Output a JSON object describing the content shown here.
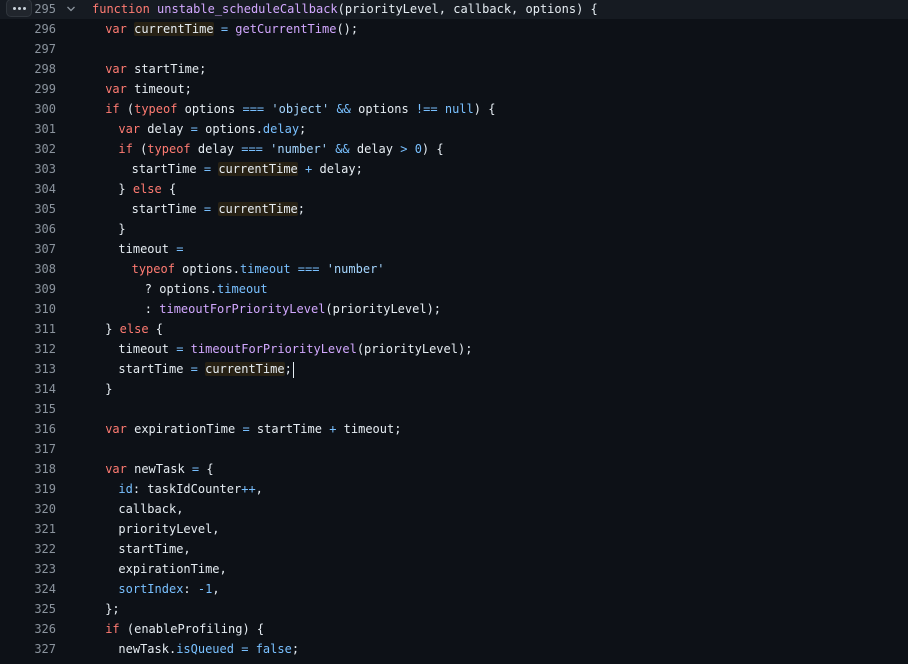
{
  "editor": {
    "indent": "  ",
    "lines": [
      {
        "n": "295",
        "indent": 0,
        "active": true,
        "tokens": [
          {
            "t": "function",
            "c": "kw"
          },
          {
            "t": " ",
            "c": "plain"
          },
          {
            "t": "unstable_scheduleCallback",
            "c": "fn"
          },
          {
            "t": "(priorityLevel, callback, options) {",
            "c": "plain"
          }
        ]
      },
      {
        "n": "296",
        "indent": 1,
        "tokens": [
          {
            "t": "var",
            "c": "kw"
          },
          {
            "t": " ",
            "c": "plain"
          },
          {
            "t": "currentTime",
            "c": "plain",
            "hl": true
          },
          {
            "t": " ",
            "c": "plain"
          },
          {
            "t": "=",
            "c": "op"
          },
          {
            "t": " ",
            "c": "plain"
          },
          {
            "t": "getCurrentTime",
            "c": "fn"
          },
          {
            "t": "();",
            "c": "plain"
          }
        ]
      },
      {
        "n": "297",
        "indent": 0,
        "tokens": []
      },
      {
        "n": "298",
        "indent": 1,
        "tokens": [
          {
            "t": "var",
            "c": "kw"
          },
          {
            "t": " startTime;",
            "c": "plain"
          }
        ]
      },
      {
        "n": "299",
        "indent": 1,
        "tokens": [
          {
            "t": "var",
            "c": "kw"
          },
          {
            "t": " timeout;",
            "c": "plain"
          }
        ]
      },
      {
        "n": "300",
        "indent": 1,
        "tokens": [
          {
            "t": "if",
            "c": "kw"
          },
          {
            "t": " (",
            "c": "plain"
          },
          {
            "t": "typeof",
            "c": "kw"
          },
          {
            "t": " options ",
            "c": "plain"
          },
          {
            "t": "===",
            "c": "op"
          },
          {
            "t": " ",
            "c": "plain"
          },
          {
            "t": "'object'",
            "c": "str"
          },
          {
            "t": " ",
            "c": "plain"
          },
          {
            "t": "&&",
            "c": "op"
          },
          {
            "t": " options ",
            "c": "plain"
          },
          {
            "t": "!==",
            "c": "op"
          },
          {
            "t": " ",
            "c": "plain"
          },
          {
            "t": "null",
            "c": "num"
          },
          {
            "t": ") {",
            "c": "plain"
          }
        ]
      },
      {
        "n": "301",
        "indent": 2,
        "tokens": [
          {
            "t": "var",
            "c": "kw"
          },
          {
            "t": " delay ",
            "c": "plain"
          },
          {
            "t": "=",
            "c": "op"
          },
          {
            "t": " options.",
            "c": "plain"
          },
          {
            "t": "delay",
            "c": "prop"
          },
          {
            "t": ";",
            "c": "plain"
          }
        ]
      },
      {
        "n": "302",
        "indent": 2,
        "tokens": [
          {
            "t": "if",
            "c": "kw"
          },
          {
            "t": " (",
            "c": "plain"
          },
          {
            "t": "typeof",
            "c": "kw"
          },
          {
            "t": " delay ",
            "c": "plain"
          },
          {
            "t": "===",
            "c": "op"
          },
          {
            "t": " ",
            "c": "plain"
          },
          {
            "t": "'number'",
            "c": "str"
          },
          {
            "t": " ",
            "c": "plain"
          },
          {
            "t": "&&",
            "c": "op"
          },
          {
            "t": " delay ",
            "c": "plain"
          },
          {
            "t": ">",
            "c": "op"
          },
          {
            "t": " ",
            "c": "plain"
          },
          {
            "t": "0",
            "c": "num"
          },
          {
            "t": ") {",
            "c": "plain"
          }
        ]
      },
      {
        "n": "303",
        "indent": 3,
        "tokens": [
          {
            "t": "startTime ",
            "c": "plain"
          },
          {
            "t": "=",
            "c": "op"
          },
          {
            "t": " ",
            "c": "plain"
          },
          {
            "t": "currentTime",
            "c": "plain",
            "hl": true
          },
          {
            "t": " ",
            "c": "plain"
          },
          {
            "t": "+",
            "c": "op"
          },
          {
            "t": " delay;",
            "c": "plain"
          }
        ]
      },
      {
        "n": "304",
        "indent": 2,
        "tokens": [
          {
            "t": "} ",
            "c": "plain"
          },
          {
            "t": "else",
            "c": "kw"
          },
          {
            "t": " {",
            "c": "plain"
          }
        ]
      },
      {
        "n": "305",
        "indent": 3,
        "tokens": [
          {
            "t": "startTime ",
            "c": "plain"
          },
          {
            "t": "=",
            "c": "op"
          },
          {
            "t": " ",
            "c": "plain"
          },
          {
            "t": "currentTime",
            "c": "plain",
            "hl": true
          },
          {
            "t": ";",
            "c": "plain"
          }
        ]
      },
      {
        "n": "306",
        "indent": 2,
        "tokens": [
          {
            "t": "}",
            "c": "plain"
          }
        ]
      },
      {
        "n": "307",
        "indent": 2,
        "tokens": [
          {
            "t": "timeout ",
            "c": "plain"
          },
          {
            "t": "=",
            "c": "op"
          }
        ]
      },
      {
        "n": "308",
        "indent": 3,
        "tokens": [
          {
            "t": "typeof",
            "c": "kw"
          },
          {
            "t": " options.",
            "c": "plain"
          },
          {
            "t": "timeout",
            "c": "prop"
          },
          {
            "t": " ",
            "c": "plain"
          },
          {
            "t": "===",
            "c": "op"
          },
          {
            "t": " ",
            "c": "plain"
          },
          {
            "t": "'number'",
            "c": "str"
          }
        ]
      },
      {
        "n": "309",
        "indent": 4,
        "tokens": [
          {
            "t": "? options.",
            "c": "plain"
          },
          {
            "t": "timeout",
            "c": "prop"
          }
        ]
      },
      {
        "n": "310",
        "indent": 4,
        "tokens": [
          {
            "t": ": ",
            "c": "plain"
          },
          {
            "t": "timeoutForPriorityLevel",
            "c": "fn"
          },
          {
            "t": "(priorityLevel);",
            "c": "plain"
          }
        ]
      },
      {
        "n": "311",
        "indent": 1,
        "tokens": [
          {
            "t": "} ",
            "c": "plain"
          },
          {
            "t": "else",
            "c": "kw"
          },
          {
            "t": " {",
            "c": "plain"
          }
        ]
      },
      {
        "n": "312",
        "indent": 2,
        "tokens": [
          {
            "t": "timeout ",
            "c": "plain"
          },
          {
            "t": "=",
            "c": "op"
          },
          {
            "t": " ",
            "c": "plain"
          },
          {
            "t": "timeoutForPriorityLevel",
            "c": "fn"
          },
          {
            "t": "(priorityLevel);",
            "c": "plain"
          }
        ]
      },
      {
        "n": "313",
        "indent": 2,
        "cursor": true,
        "tokens": [
          {
            "t": "startTime ",
            "c": "plain"
          },
          {
            "t": "=",
            "c": "op"
          },
          {
            "t": " ",
            "c": "plain"
          },
          {
            "t": "currentTime",
            "c": "plain",
            "hl": true
          },
          {
            "t": ";",
            "c": "plain"
          }
        ]
      },
      {
        "n": "314",
        "indent": 1,
        "tokens": [
          {
            "t": "}",
            "c": "plain"
          }
        ]
      },
      {
        "n": "315",
        "indent": 0,
        "tokens": []
      },
      {
        "n": "316",
        "indent": 1,
        "tokens": [
          {
            "t": "var",
            "c": "kw"
          },
          {
            "t": " expirationTime ",
            "c": "plain"
          },
          {
            "t": "=",
            "c": "op"
          },
          {
            "t": " startTime ",
            "c": "plain"
          },
          {
            "t": "+",
            "c": "op"
          },
          {
            "t": " timeout;",
            "c": "plain"
          }
        ]
      },
      {
        "n": "317",
        "indent": 0,
        "tokens": []
      },
      {
        "n": "318",
        "indent": 1,
        "tokens": [
          {
            "t": "var",
            "c": "kw"
          },
          {
            "t": " newTask ",
            "c": "plain"
          },
          {
            "t": "=",
            "c": "op"
          },
          {
            "t": " {",
            "c": "plain"
          }
        ]
      },
      {
        "n": "319",
        "indent": 2,
        "tokens": [
          {
            "t": "id",
            "c": "prop"
          },
          {
            "t": ": taskIdCounter",
            "c": "plain"
          },
          {
            "t": "++",
            "c": "op"
          },
          {
            "t": ",",
            "c": "plain"
          }
        ]
      },
      {
        "n": "320",
        "indent": 2,
        "tokens": [
          {
            "t": "callback,",
            "c": "plain"
          }
        ]
      },
      {
        "n": "321",
        "indent": 2,
        "tokens": [
          {
            "t": "priorityLevel,",
            "c": "plain"
          }
        ]
      },
      {
        "n": "322",
        "indent": 2,
        "tokens": [
          {
            "t": "startTime,",
            "c": "plain"
          }
        ]
      },
      {
        "n": "323",
        "indent": 2,
        "tokens": [
          {
            "t": "expirationTime,",
            "c": "plain"
          }
        ]
      },
      {
        "n": "324",
        "indent": 2,
        "tokens": [
          {
            "t": "sortIndex",
            "c": "prop"
          },
          {
            "t": ": ",
            "c": "plain"
          },
          {
            "t": "-1",
            "c": "num"
          },
          {
            "t": ",",
            "c": "plain"
          }
        ]
      },
      {
        "n": "325",
        "indent": 1,
        "tokens": [
          {
            "t": "};",
            "c": "plain"
          }
        ]
      },
      {
        "n": "326",
        "indent": 1,
        "tokens": [
          {
            "t": "if",
            "c": "kw"
          },
          {
            "t": " (enableProfiling) {",
            "c": "plain"
          }
        ]
      },
      {
        "n": "327",
        "indent": 2,
        "tokens": [
          {
            "t": "newTask.",
            "c": "plain"
          },
          {
            "t": "isQueued",
            "c": "prop"
          },
          {
            "t": " ",
            "c": "plain"
          },
          {
            "t": "=",
            "c": "op"
          },
          {
            "t": " ",
            "c": "plain"
          },
          {
            "t": "false",
            "c": "num"
          },
          {
            "t": ";",
            "c": "plain"
          }
        ]
      }
    ]
  }
}
